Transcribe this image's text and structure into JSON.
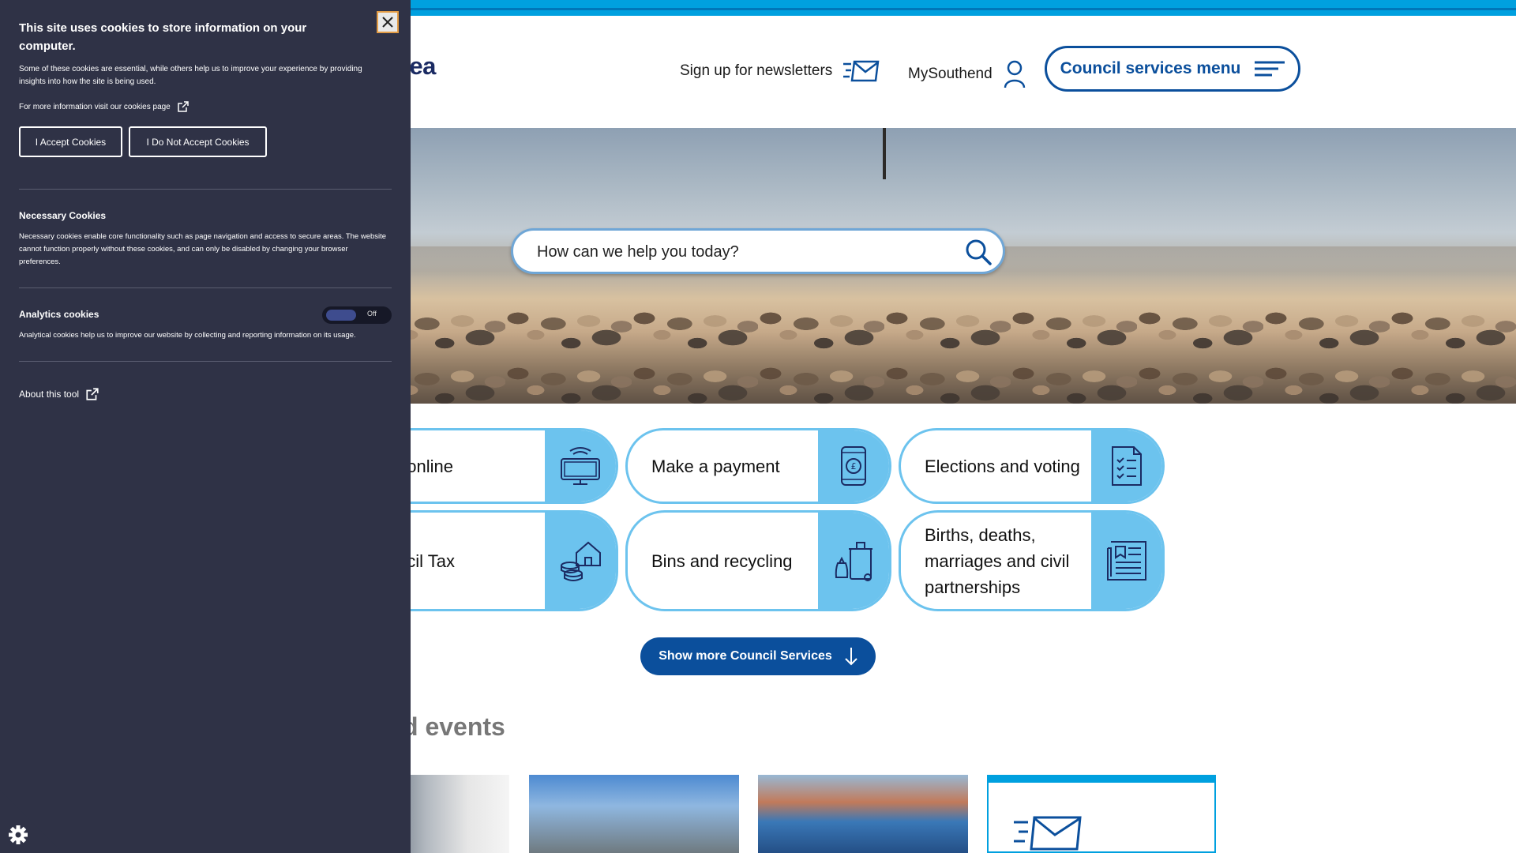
{
  "header": {
    "logo_text": "n·Sea",
    "newsletter_label": "Sign up for newsletters",
    "mysouthend_label": "MySouthend",
    "menu_label": "Council services menu"
  },
  "search": {
    "placeholder": "How can we help you today?"
  },
  "services": [
    {
      "label": "t online",
      "icon": "computer-icon"
    },
    {
      "label": "Make a payment",
      "icon": "phone-payment-icon"
    },
    {
      "label": "Elections and voting",
      "icon": "checklist-icon"
    },
    {
      "label": "ncil Tax",
      "icon": "house-coins-icon"
    },
    {
      "label": "Bins and recycling",
      "icon": "bin-icon"
    },
    {
      "label": "Births, deaths, marriages and civil partnerships",
      "icon": "document-icon"
    }
  ],
  "show_more_label": "Show more Council Services",
  "news": {
    "heading": "d events"
  },
  "cookie": {
    "title": "This site uses cookies to store information on your computer.",
    "intro": "Some of these cookies are essential, while others help us to improve your experience by providing insights into how the site is being used.",
    "more_info": "For more information visit our cookies page",
    "accept_label": "I Accept Cookies",
    "reject_label": "I Do Not Accept Cookies",
    "necessary_title": "Necessary Cookies",
    "necessary_text": "Necessary cookies enable core functionality such as page navigation and access to secure areas. The website cannot function properly without these cookies, and can only be disabled by changing your browser preferences.",
    "analytics_title": "Analytics cookies",
    "analytics_text": "Analytical cookies help us to improve our website by collecting and reporting information on its usage.",
    "analytics_toggle": "Off",
    "about_label": "About this tool"
  },
  "colors": {
    "brand_blue": "#0b4f9c",
    "accent_light_blue": "#6cc3ee",
    "cookie_panel": "#2f3246"
  }
}
